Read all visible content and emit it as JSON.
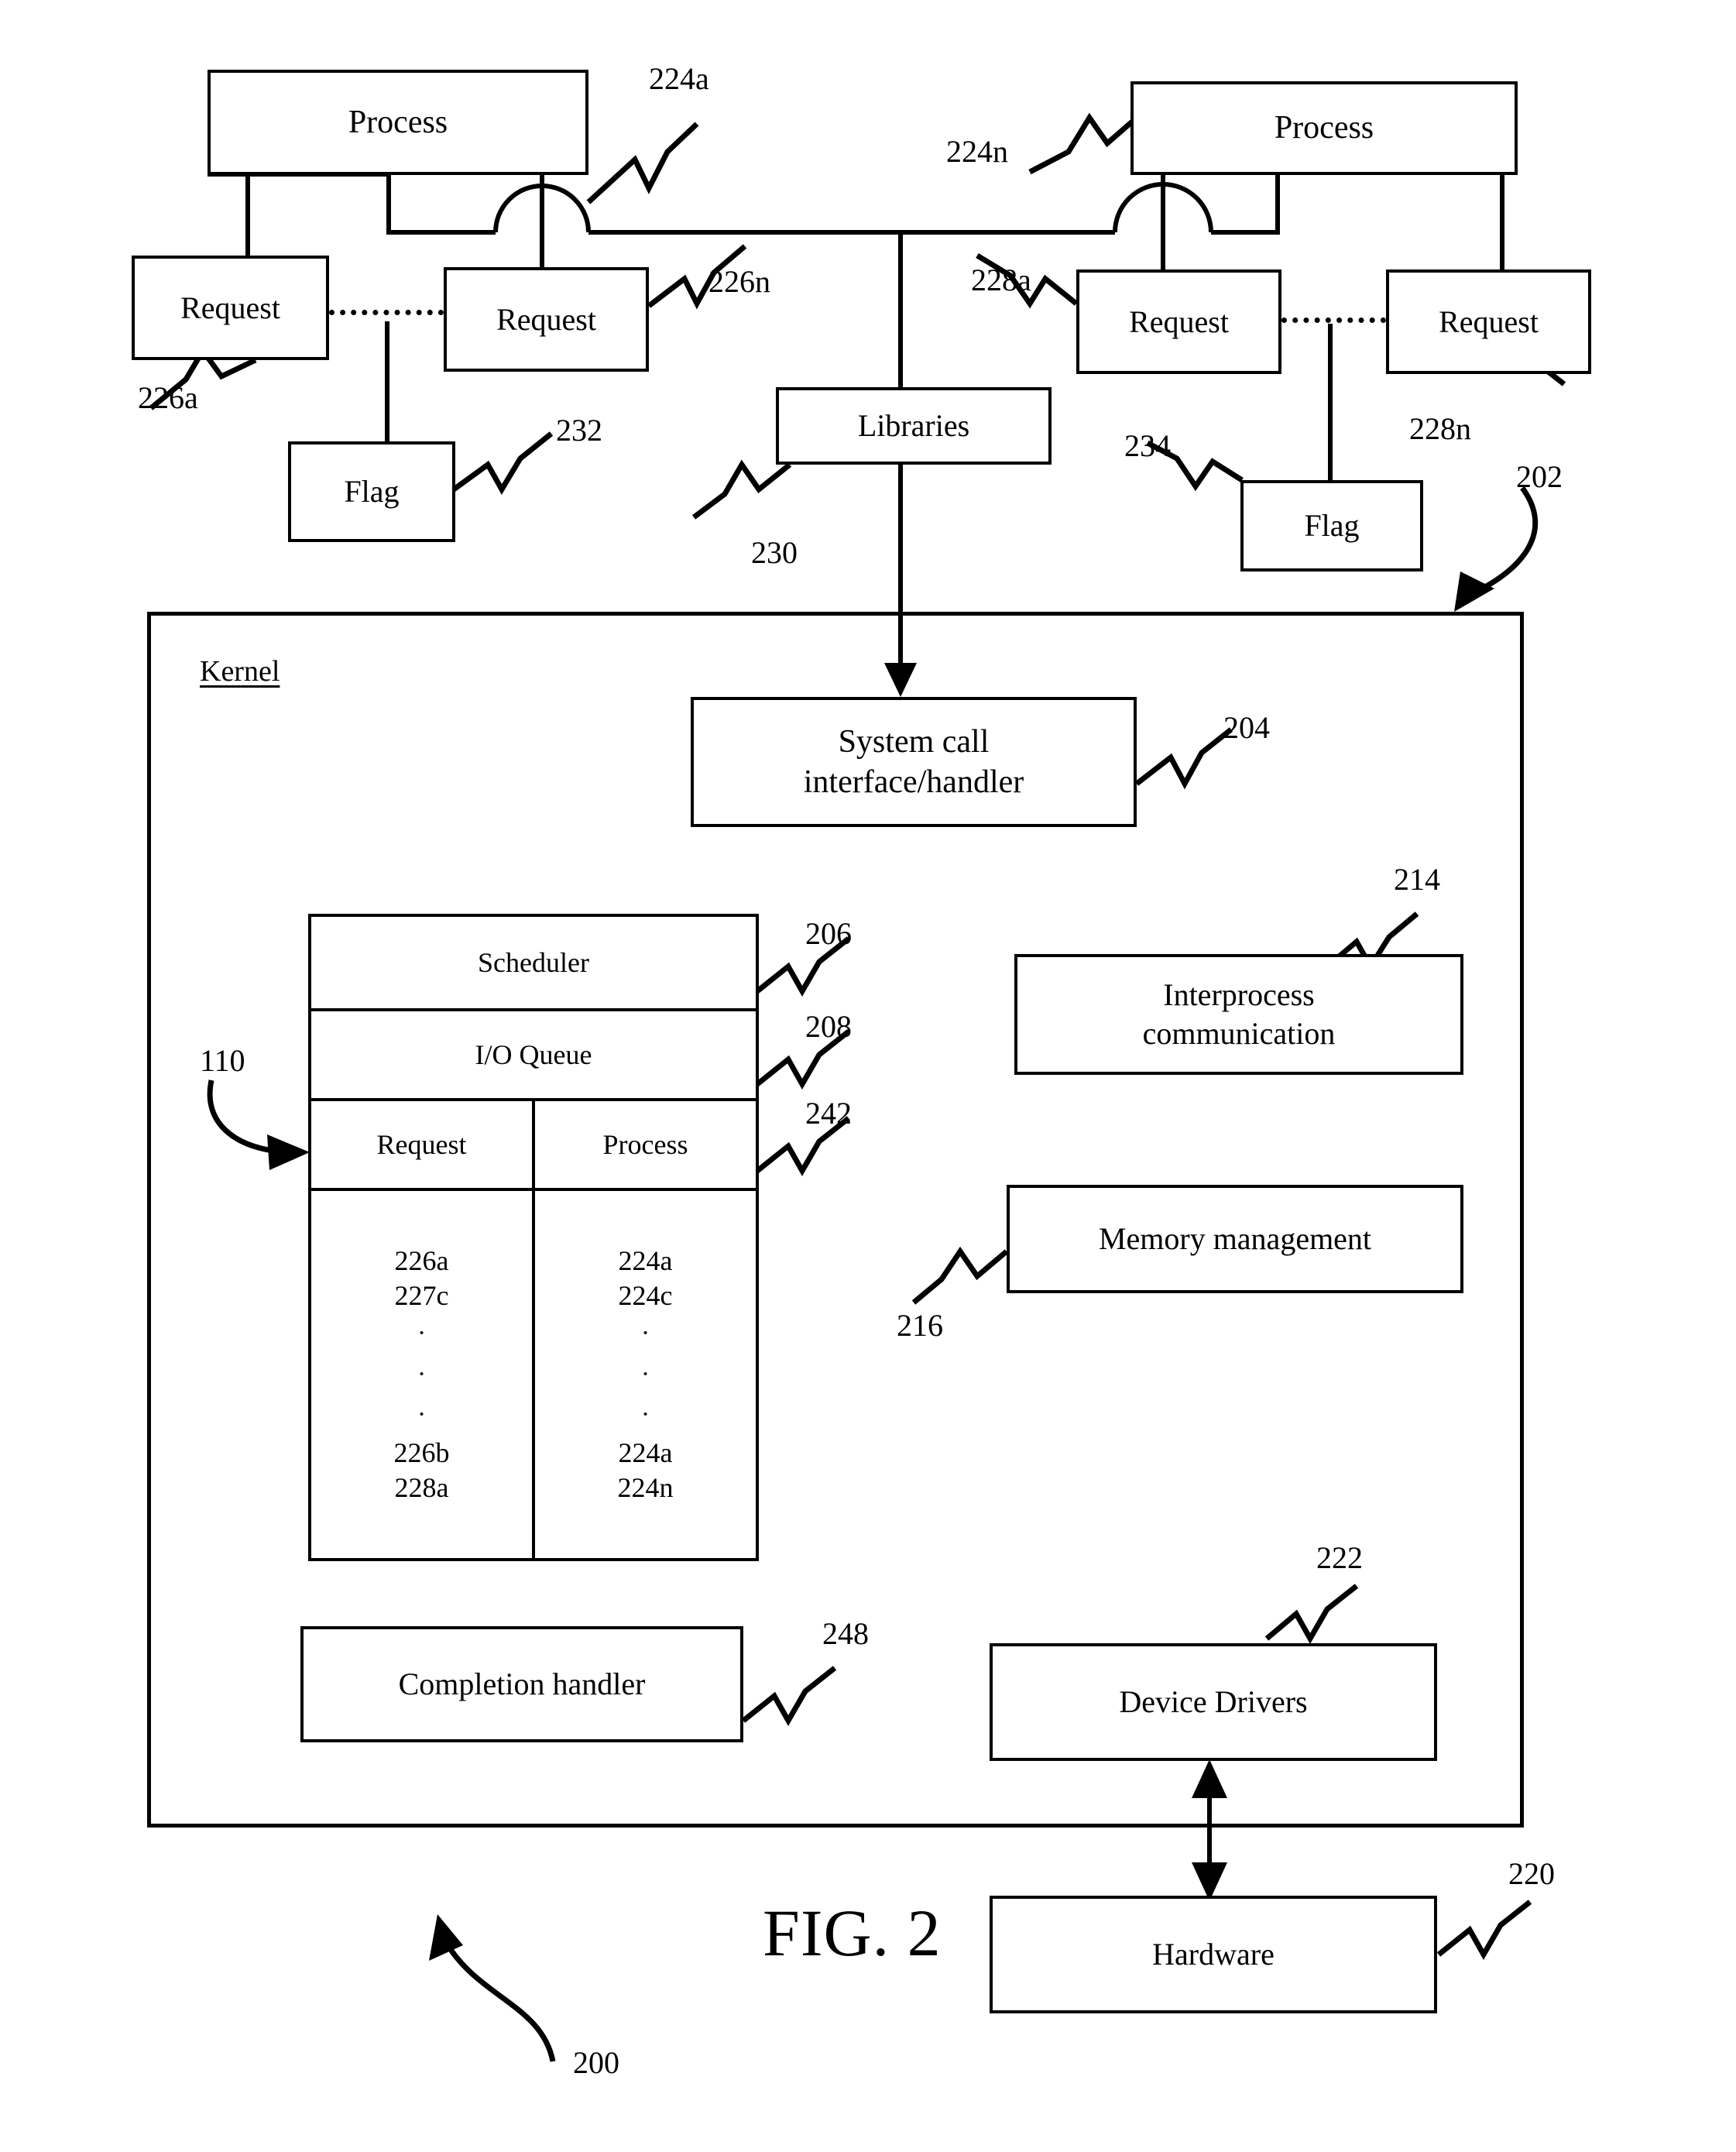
{
  "figure": {
    "caption": "FIG. 2",
    "overall_ref": "200"
  },
  "userspace": {
    "process_left": {
      "label": "Process",
      "ref": "224a"
    },
    "process_right": {
      "label": "Process",
      "ref": "224n"
    },
    "request_left_a": {
      "label": "Request",
      "ref": "226a"
    },
    "request_left_n": {
      "label": "Request",
      "ref": "226n"
    },
    "request_right_a": {
      "label": "Request",
      "ref": "228a"
    },
    "request_right_n": {
      "label": "Request",
      "ref": "228n"
    },
    "flag_left": {
      "label": "Flag",
      "ref": "232"
    },
    "flag_right": {
      "label": "Flag",
      "ref": "234"
    },
    "libraries": {
      "label": "Libraries",
      "ref": "230"
    }
  },
  "kernel": {
    "title": "Kernel",
    "ref": "202",
    "system_call": {
      "line1": "System call",
      "line2": "interface/handler",
      "ref": "204"
    },
    "scheduler": {
      "label": "Scheduler",
      "ref": "206"
    },
    "io_queue": {
      "label": "I/O Queue",
      "ref": "208"
    },
    "queue_table": {
      "ref_header": "242",
      "ref_table": "110",
      "headers": [
        "Request",
        "Process"
      ],
      "rows": [
        {
          "request": "226a",
          "process": "224a"
        },
        {
          "request": "227c",
          "process": "224c"
        }
      ],
      "ellipsis": [
        "·",
        "·",
        "·"
      ],
      "rows_end": [
        {
          "request": "226b",
          "process": "224a"
        },
        {
          "request": "228a",
          "process": "224n"
        }
      ]
    },
    "interprocess": {
      "line1": "Interprocess",
      "line2": "communication",
      "ref": "214"
    },
    "memory_management": {
      "label": "Memory management",
      "ref": "216"
    },
    "completion_handler": {
      "label": "Completion handler",
      "ref": "248"
    },
    "device_drivers": {
      "label": "Device Drivers",
      "ref": "222"
    }
  },
  "hardware": {
    "label": "Hardware",
    "ref": "220"
  },
  "colors": {
    "ink": "#000000",
    "paper": "#ffffff"
  }
}
